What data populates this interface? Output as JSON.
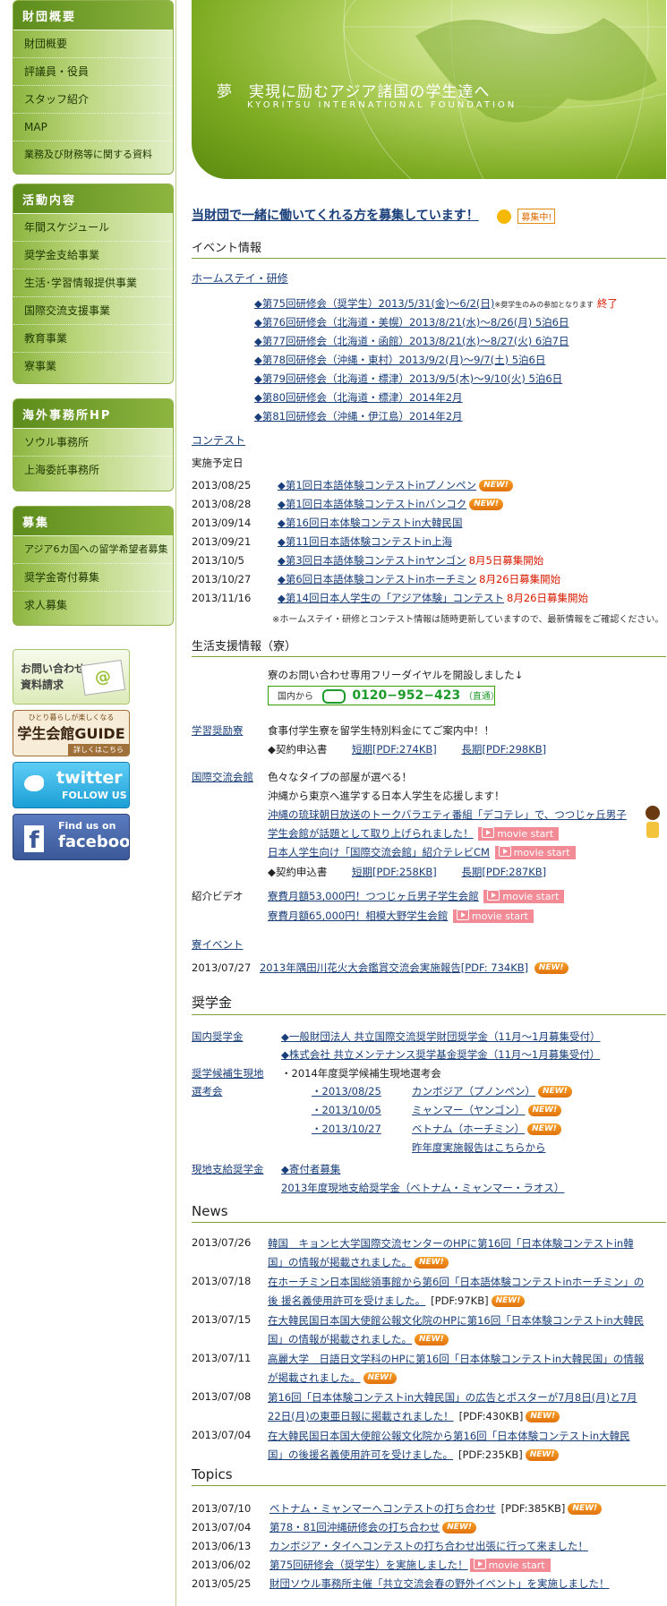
{
  "sidebar": {
    "sections": [
      {
        "title": "財団概要",
        "items": [
          "財団概要",
          "評議員・役員",
          "スタッフ紹介",
          "MAP",
          "業務及び財務等に関する資料"
        ]
      },
      {
        "title": "活動内容",
        "items": [
          "年間スケジュール",
          "奨学金支給事業",
          "生活･学習情報提供事業",
          "国際交流支援事業",
          "教育事業",
          "寮事業"
        ]
      },
      {
        "title": "海外事務所HP",
        "items": [
          "ソウル事務所",
          "上海委託事務所"
        ]
      },
      {
        "title": "募集",
        "items": [
          "アジア6カ国への留学希望者募集",
          "奨学金寄付募集",
          "求人募集"
        ]
      }
    ],
    "banners": {
      "contact_line1": "お問い合わせ",
      "contact_line2": "資料請求",
      "guide_top": "ひとり暮らしが楽しくなる",
      "guide_title": "学生会館GUIDE",
      "guide_more": "詳しくはこちら",
      "twitter": "twitter",
      "twitter_sub": "FOLLOW US",
      "facebook_top": "Find us on",
      "facebook": "facebook"
    }
  },
  "hero": {
    "title": "夢　実現に励むアジア諸国の学生達へ",
    "subtitle": "KYORITSU INTERNATIONAL FOUNDATION"
  },
  "recruit": {
    "text": "当財団で一緒に働いてくれる方を募集しています！",
    "badge": "募集中!"
  },
  "badge_new": "NEW!",
  "movie_label": "movie start",
  "events": {
    "heading": "イベント情報",
    "homestay_title": "ホームステイ・研修",
    "homestay": [
      {
        "text": "◆第75回研修会（奨学生）2013/5/31(金)～6/2(日)",
        "note": "※奨学生のみの参加となります",
        "status": "終了"
      },
      {
        "text": "◆第76回研修会（北海道・美幌）2013/8/21(水)～8/26(月) 5泊6日"
      },
      {
        "text": "◆第77回研修会（北海道・函館）2013/8/21(水)～8/27(火) 6泊7日"
      },
      {
        "text": "◆第78回研修会（沖縄・東村）2013/9/2(月)～9/7(土) 5泊6日"
      },
      {
        "text": "◆第79回研修会（北海道・標津）2013/9/5(木)～9/10(火) 5泊6日"
      },
      {
        "text": "◆第80回研修会（北海道・標津）2014年2月"
      },
      {
        "text": "◆第81回研修会（沖縄・伊江島）2014年2月"
      }
    ],
    "contest_title": "コンテスト",
    "contest_label": "実施予定日",
    "contests": [
      {
        "date": "2013/08/25",
        "text": "◆第1回日本語体験コンテストinプノンペン",
        "status": ""
      },
      {
        "date": "2013/08/28",
        "text": "◆第1回日本語体験コンテストinバンコク",
        "status": ""
      },
      {
        "date": "2013/09/14",
        "text": "◆第16回日本体験コンテストin大韓民国",
        "status": ""
      },
      {
        "date": "2013/09/21",
        "text": "◆第11回日本語体験コンテストin上海",
        "status": ""
      },
      {
        "date": "2013/10/5",
        "text": "◆第3回日本語体験コンテストinヤンゴン",
        "status": "8月5日募集開始"
      },
      {
        "date": "2013/10/27",
        "text": "◆第6回日本語体験コンテストinホーチミン",
        "status": "8月26日募集開始"
      },
      {
        "date": "2013/11/16",
        "text": "◆第14回日本人学生の「アジア体験」コンテスト",
        "status": "8月26日募集開始"
      }
    ],
    "note": "※ホームステイ・研修とコンテスト情報は随時更新していますので、最新情報をご確認ください。"
  },
  "life": {
    "heading": "生活支援情報（寮）",
    "freedial_text": "寮のお問い合わせ専用フリーダイヤルを開設しました↓",
    "freedial_from": "国内から",
    "freedial_number": "0120−952−423",
    "freedial_direct": "（直通）",
    "gakushu_label": "学習奨励寮",
    "gakushu_text": "食事付学生寮を留学生特別料金にてご案内中！！",
    "contract": "◆契約申込書",
    "gakushu_short": "短期[PDF:274KB]",
    "gakushu_long": "長期[PDF:298KB]",
    "kokusai_label": "国際交流会館",
    "kokusai_line1": "色々なタイプの部屋が選べる！",
    "kokusai_line2": "沖縄から東京へ進学する日本人学生を応援します！",
    "kokusai_link1a": "沖縄の琉球朝日放送のトークバラエティ番組「デコテレ」で、つつじヶ丘男子",
    "kokusai_link1b": "学生会館が話題として取り上げられました！",
    "kokusai_link2": "日本人学生向け「国際交流会館」紹介テレビCM",
    "kokusai_short": "短期[PDF:258KB]",
    "kokusai_long": "長期[PDF:287KB]",
    "video_label": "紹介ビデオ",
    "video1": "寮費月額53,000円！つつじヶ丘男子学生会館",
    "video2": "寮費月額65,000円！相模大野学生会館",
    "ryo_event_title": "寮イベント",
    "ryo_event_date": "2013/07/27",
    "ryo_event_text": "2013年隅田川花火大会鑑賞交流会実施報告[PDF: 734KB]"
  },
  "scholarship": {
    "heading": "奨学金",
    "domestic_label": "国内奨学金",
    "domestic1": "◆一般財団法人 共立国際交流奨学財団奨学金（11月～1月募集受付）",
    "domestic2": "◆株式会社 共立メンテナンス奨学基金奨学金（11月～1月募集受付）",
    "candidate_label1": "奨学候補生現地",
    "candidate_label2": "選考会",
    "candidate_intro": "・2014年度奨学候補生現地選考会",
    "candidates": [
      {
        "date": "・2013/08/25",
        "country": "カンボジア（プノンペン）"
      },
      {
        "date": "・2013/10/05",
        "country": "ミャンマー（ヤンゴン）"
      },
      {
        "date": "・2013/10/27",
        "country": "ベトナム（ホーチミン）"
      }
    ],
    "last_year": "昨年度実施報告はこちらから",
    "local_label": "現地支給奨学金",
    "local1": "◆寄付者募集",
    "local2": "2013年度現地支給奨学金（ベトナム・ミャンマー・ラオス）"
  },
  "news": {
    "heading": "News",
    "items": [
      {
        "date": "2013/07/26",
        "line1": "韓国　キョンヒ大学国際交流センターのHPに第16回「日本体験コンテストin韓",
        "line2": "国」の情報が掲載されました。",
        "pdf": ""
      },
      {
        "date": "2013/07/18",
        "line1": "在ホーチミン日本国総領事館から第6回「日本語体験コンテストinホーチミン」の",
        "line2": "後 援名義使用許可を受けました。",
        "pdf": "[PDF:97KB]"
      },
      {
        "date": "2013/07/15",
        "line1": "在大韓民国日本国大使館公報文化院のHPに第16回「日本体験コンテストin大韓民",
        "line2": "国」の情報が掲載されました。",
        "pdf": ""
      },
      {
        "date": "2013/07/11",
        "line1": "高麗大学　日語日文学科のHPに第16回「日本体験コンテストin大韓民国」の情報",
        "line2": "が掲載されました。",
        "pdf": ""
      },
      {
        "date": "2013/07/08",
        "line1": "第16回「日本体験コンテストin大韓民国」の広告とポスターが7月8日(月)と7月",
        "line2": "22日(月)の東亜日報に掲載されました！",
        "pdf": "[PDF:430KB]"
      },
      {
        "date": "2013/07/04",
        "line1": "在大韓民国日本国大使館公報文化院から第16回「日本体験コンテストin大韓民",
        "line2": "国」の後援名義使用許可を受けました。",
        "pdf": "[PDF:235KB]"
      }
    ]
  },
  "topics": {
    "heading": "Topics",
    "items": [
      {
        "date": "2013/07/10",
        "text": "ベトナム・ミャンマーへコンテストの打ち合わせ",
        "pdf": "[PDF:385KB]"
      },
      {
        "date": "2013/07/04",
        "text": "第78・81回沖縄研修会の打ち合わせ",
        "pdf": ""
      },
      {
        "date": "2013/06/13",
        "text": "カンボジア・タイへコンテストの打ち合わせ出張に行って来ました！",
        "pdf": ""
      },
      {
        "date": "2013/06/02",
        "text": "第75回研修会（奨学生）を実施しました！",
        "pdf": ""
      },
      {
        "date": "2013/05/25",
        "text": "財団ソウル事務所主催「共立交流会春の野外イベント」を実施しました！",
        "pdf": ""
      }
    ]
  }
}
